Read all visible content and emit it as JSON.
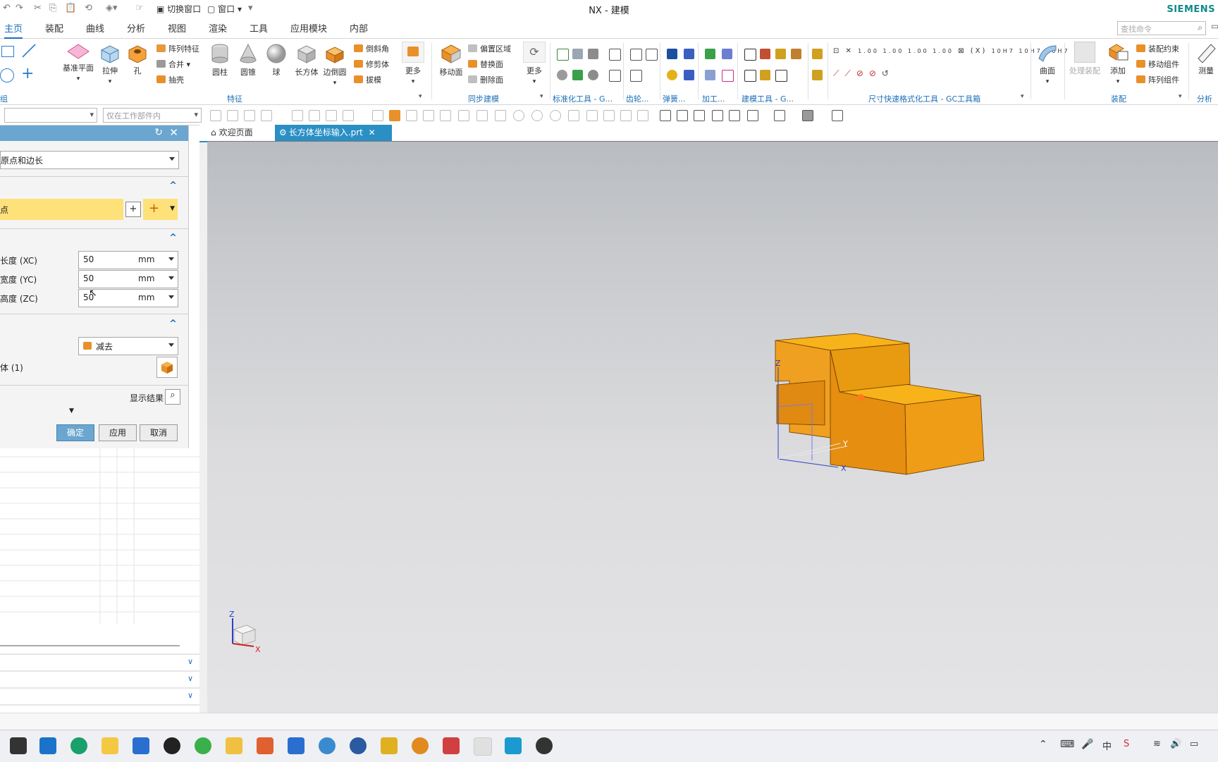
{
  "window": {
    "title": "NX - 建模",
    "brand": "SIEMENS"
  },
  "quick_access": {
    "switch_window": "切换窗口",
    "window_menu": "窗口"
  },
  "menu_tabs": [
    "主页",
    "装配",
    "曲线",
    "分析",
    "视图",
    "渲染",
    "工具",
    "应用模块",
    "内部"
  ],
  "search": {
    "placeholder": "查找命令"
  },
  "ribbon": {
    "datum_plane": "基准平面",
    "extrude": "拉伸",
    "hole": "孔",
    "pattern_feature": "阵列特征",
    "unite": "合并",
    "shell": "抽壳",
    "cylinder": "圆柱",
    "cone": "圆锥",
    "sphere": "球",
    "block": "长方体",
    "edge_blend": "边倒圆",
    "chamfer": "倒斜角",
    "trim_body": "修剪体",
    "draft": "拔模",
    "more": "更多",
    "move_face": "移动面",
    "offset_region": "偏置区域",
    "replace_face": "替换面",
    "delete_face": "删除面",
    "more2": "更多",
    "surface": "曲面",
    "process_assembly": "处理装配",
    "add": "添加",
    "assembly_constraints": "装配约束",
    "move_component": "移动组件",
    "pattern_component": "阵列组件",
    "measure": "测量",
    "groups": {
      "feature": "特征",
      "sync_modeling": "同步建模",
      "std_tools": "标准化工具 - G...",
      "gear": "齿轮...",
      "spring": "弹簧...",
      "machining": "加工...",
      "modeling_tools": "建模工具 - G...",
      "dim_tools": "尺寸快速格式化工具 - GC工具箱",
      "assembly": "装配",
      "analysis": "分析",
      "left_partial": "组"
    }
  },
  "selection": {
    "filter_value": "",
    "scope": "仅在工作部件内"
  },
  "doc_tabs": [
    {
      "label": "欢迎页面"
    },
    {
      "label": "长方体坐标输入.prt"
    }
  ],
  "dialog": {
    "type_value": "原点和边长",
    "origin_label": "点",
    "dims": [
      {
        "label": "长度 (XC)",
        "value": "50",
        "unit": "mm"
      },
      {
        "label": "宽度 (YC)",
        "value": "50",
        "unit": "mm"
      },
      {
        "label": "高度 (ZC)",
        "value": "50",
        "unit": "mm"
      }
    ],
    "boolean_value": "减去",
    "body_label": "体 (1)",
    "show_result": "显示结果",
    "ok": "确定",
    "apply": "应用",
    "cancel": "取消"
  },
  "axes": {
    "x": "X",
    "y": "Y",
    "z": "Z"
  },
  "colors": {
    "accent": "#1b6fb8",
    "model": "#f0a020",
    "dialog_header": "#6aa6cf",
    "ok_button": "#6aa6cf",
    "highlight": "#ffe17a"
  }
}
